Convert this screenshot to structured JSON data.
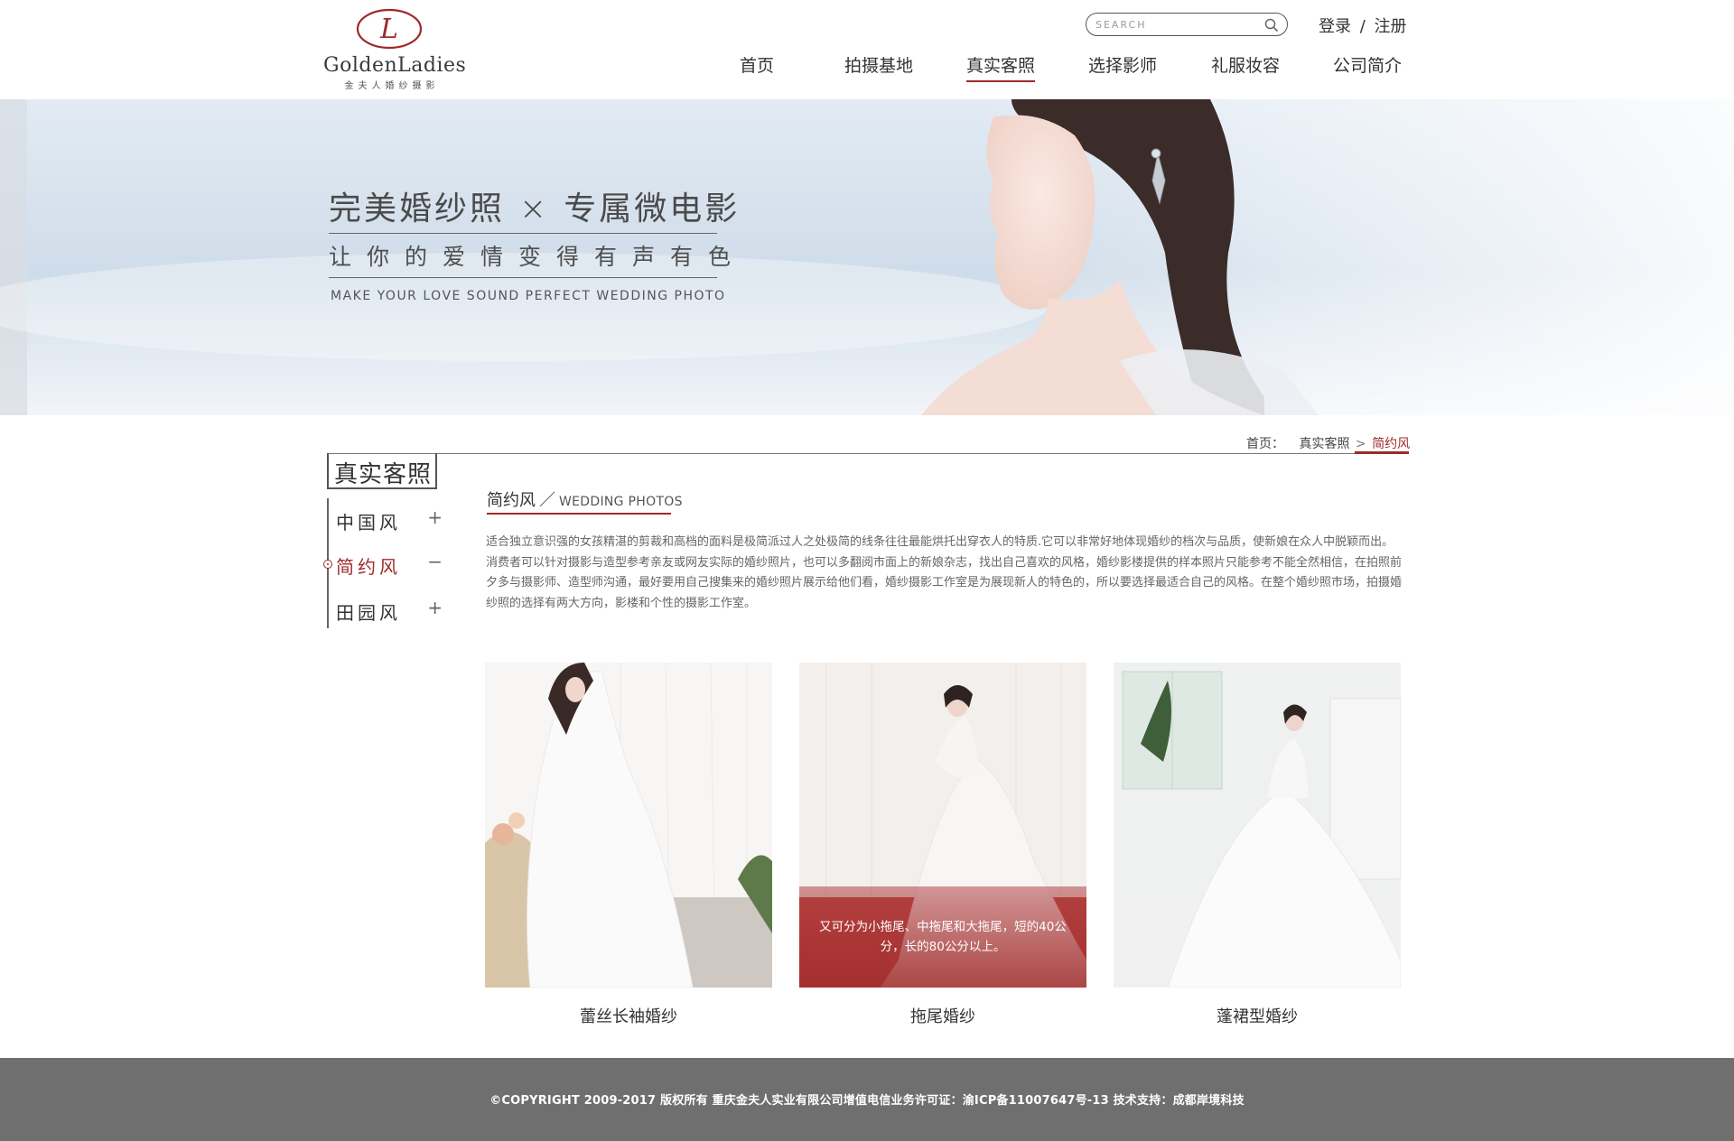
{
  "header": {
    "logo": {
      "name": "GoldenLadies",
      "subtitle": "金夫人婚纱摄影",
      "monogram": "L"
    },
    "search": {
      "placeholder": "SEARCH",
      "icon": "search-icon"
    },
    "auth": {
      "login": "登录",
      "separator": "/",
      "register": "注册"
    },
    "nav": [
      {
        "label": "首页",
        "active": false
      },
      {
        "label": "拍摄基地",
        "active": false
      },
      {
        "label": "真实客照",
        "active": true
      },
      {
        "label": "选择影师",
        "active": false
      },
      {
        "label": "礼服妆容",
        "active": false
      },
      {
        "label": "公司简介",
        "active": false
      }
    ],
    "accent_color": "#9e2a2b"
  },
  "banner": {
    "title_left": "完美婚纱照",
    "title_times": "×",
    "title_right": "专属微电影",
    "subtitle": "让你的爱情变得有声有色",
    "english": "MAKE YOUR LOVE SOUND PERFECT WEDDING PHOTO"
  },
  "breadcrumb": {
    "home": "首页：",
    "section": "真实客照",
    "arrow": ">",
    "current": "简约风"
  },
  "sidebar": {
    "title": "真实客照",
    "items": [
      {
        "label": "中国风",
        "sign": "+",
        "active": false
      },
      {
        "label": "简约风",
        "sign": "−",
        "active": true
      },
      {
        "label": "田园风",
        "sign": "+",
        "active": false
      }
    ]
  },
  "main": {
    "heading_cn": "简约风",
    "heading_slash": "／",
    "heading_en": "WEDDING PHOTOS",
    "description": "适合独立意识强的女孩精湛的剪裁和高档的面料是极简派过人之处极简的线条往往最能烘托出穿衣人的特质.它可以非常好地体现婚纱的档次与品质，使新娘在众人中脱颖而出。消费者可以针对摄影与造型参考亲友或网友实际的婚纱照片，也可以多翻阅市面上的新娘杂志，找出自己喜欢的风格，婚纱影楼提供的样本照片只能参考不能全然相信，在拍照前夕多与摄影师、造型师沟通，最好要用自己搜集来的婚纱照片展示给他们看，婚纱摄影工作室是为展现新人的特色的，所以要选择最适合自己的风格。在整个婚纱照市场，拍摄婚纱照的选择有两大方向，影楼和个性的摄影工作室。",
    "gallery": [
      {
        "caption": "蕾丝长袖婚纱",
        "overlay": ""
      },
      {
        "caption": "拖尾婚纱",
        "overlay": "又可分为小拖尾、中拖尾和大拖尾，短的40公分，长的80公分以上。"
      },
      {
        "caption": "蓬裙型婚纱",
        "overlay": ""
      }
    ]
  },
  "footer": {
    "copyright": "©COPYRIGHT 2009-2017 版权所有 重庆金夫人实业有限公司增值电信业务许可证：渝ICP备11007647号-13   技术支持：成都岸境科技"
  }
}
